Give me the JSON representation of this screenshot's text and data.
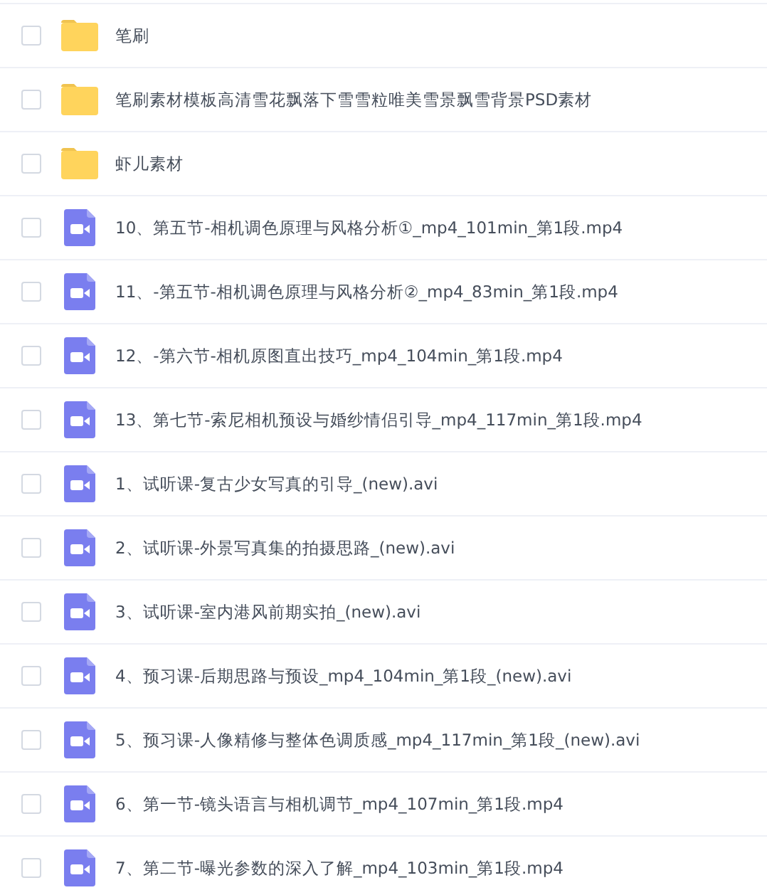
{
  "files": [
    {
      "kind": "folder",
      "name": "笔刷",
      "checked": false
    },
    {
      "kind": "folder",
      "name": "笔刷素材模板高清雪花飘落下雪雪粒唯美雪景飘雪背景PSD素材",
      "checked": false
    },
    {
      "kind": "folder",
      "name": "虾儿素材",
      "checked": false
    },
    {
      "kind": "video",
      "name": "10、第五节-相机调色原理与风格分析①_mp4_101min_第1段.mp4",
      "checked": false
    },
    {
      "kind": "video",
      "name": "11、-第五节-相机调色原理与风格分析②_mp4_83min_第1段.mp4",
      "checked": false
    },
    {
      "kind": "video",
      "name": "12、-第六节-相机原图直出技巧_mp4_104min_第1段.mp4",
      "checked": false
    },
    {
      "kind": "video",
      "name": "13、第七节-索尼相机预设与婚纱情侣引导_mp4_117min_第1段.mp4",
      "checked": false
    },
    {
      "kind": "video",
      "name": "1、试听课-复古少女写真的引导_(new).avi",
      "checked": false
    },
    {
      "kind": "video",
      "name": "2、试听课-外景写真集的拍摄思路_(new).avi",
      "checked": false
    },
    {
      "kind": "video",
      "name": "3、试听课-室内港风前期实拍_(new).avi",
      "checked": false
    },
    {
      "kind": "video",
      "name": "4、预习课-后期思路与预设_mp4_104min_第1段_(new).avi",
      "checked": false
    },
    {
      "kind": "video",
      "name": "5、预习课-人像精修与整体色调质感_mp4_117min_第1段_(new).avi",
      "checked": false
    },
    {
      "kind": "video",
      "name": "6、第一节-镜头语言与相机调节_mp4_107min_第1段.mp4",
      "checked": false
    },
    {
      "kind": "video",
      "name": "7、第二节-曝光参数的深入了解_mp4_103min_第1段.mp4",
      "checked": false
    }
  ]
}
